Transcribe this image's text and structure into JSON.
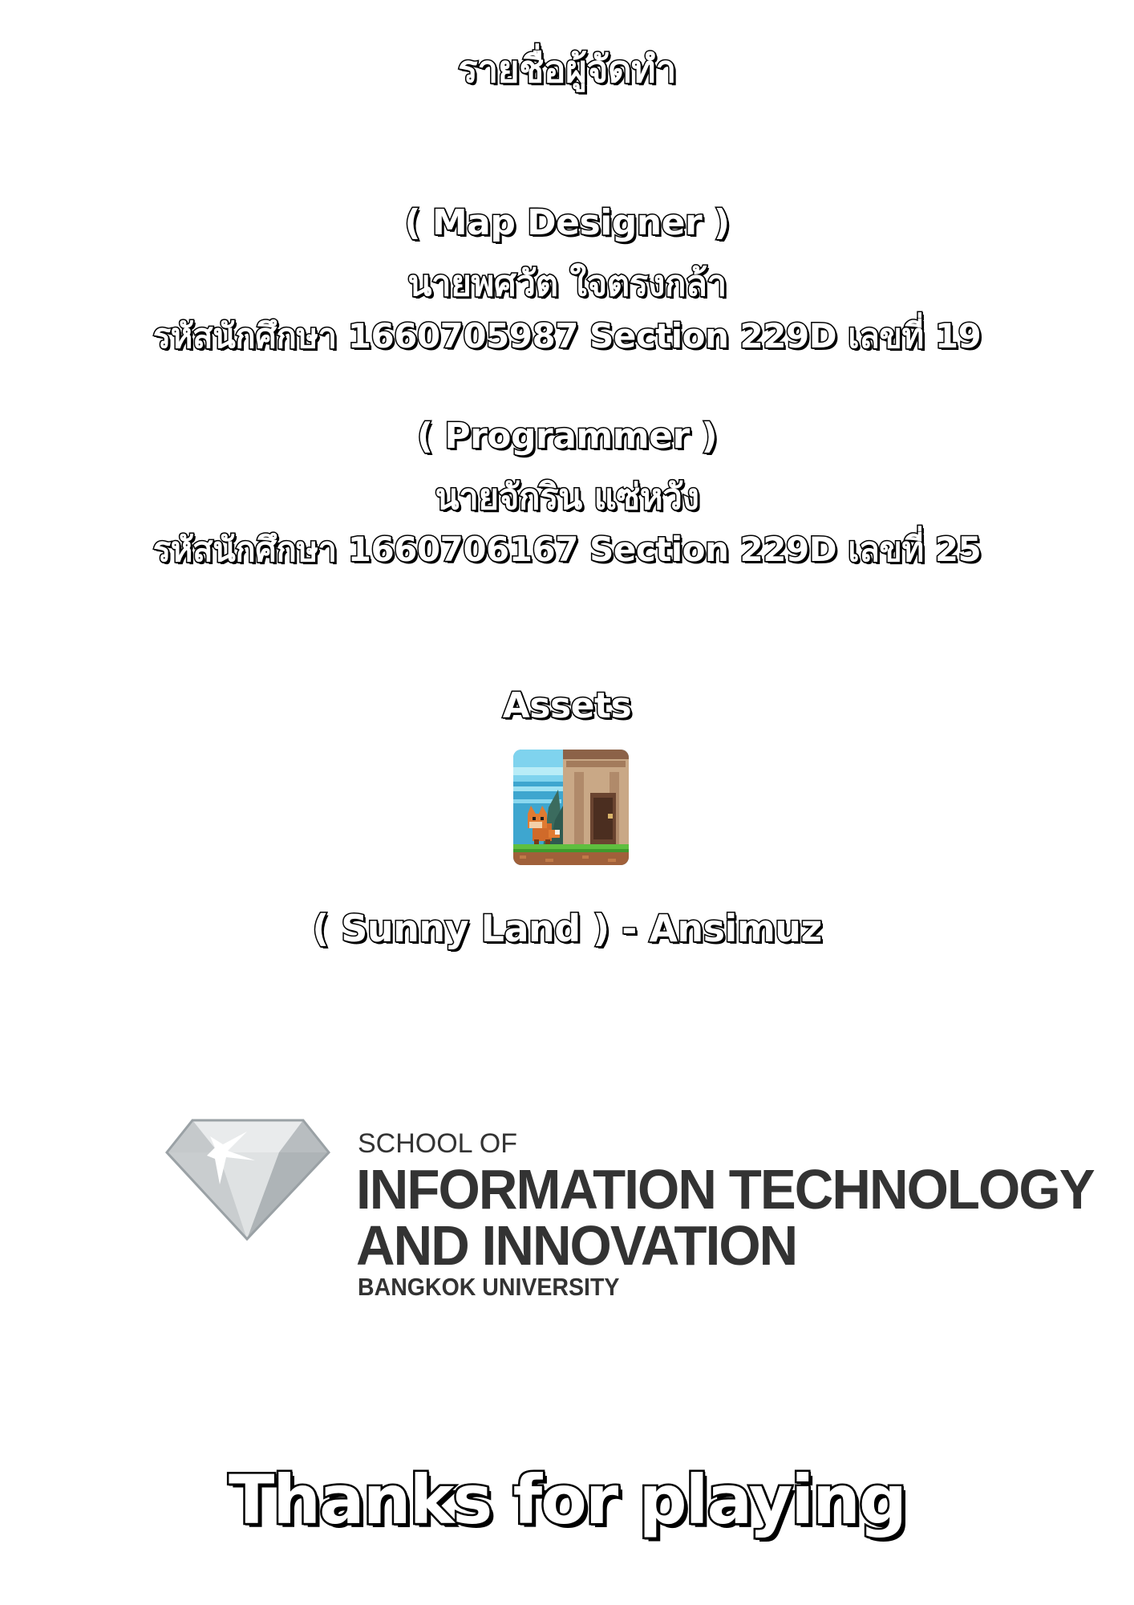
{
  "credits": {
    "title": "รายชื่อผู้จัดทำ",
    "members": [
      {
        "role": "( Map Designer )",
        "name": "นายพศวัต ใจตรงกล้า",
        "student_line": "รหัสนักศึกษา 1660705987  Section 229D  เลขที่ 19"
      },
      {
        "role": "( Programmer )",
        "name": "นายจักริน แซ่หวัง",
        "student_line": "รหัสนักศึกษา 1660706167 Section 229D เลขที่ 25"
      }
    ],
    "assets_heading": "Assets",
    "asset_credit": "( Sunny Land )  -  Ansimuz",
    "asset_thumbnail_icon": "sunny-land-thumbnail"
  },
  "logo": {
    "icon": "diamond-icon",
    "line1": "SCHOOL OF",
    "line2": "INFORMATION TECHNOLOGY",
    "line3": "AND INNOVATION",
    "line4": "BANGKOK UNIVERSITY",
    "text_color": "#333333"
  },
  "footer": {
    "thanks": "Thanks for playing"
  }
}
